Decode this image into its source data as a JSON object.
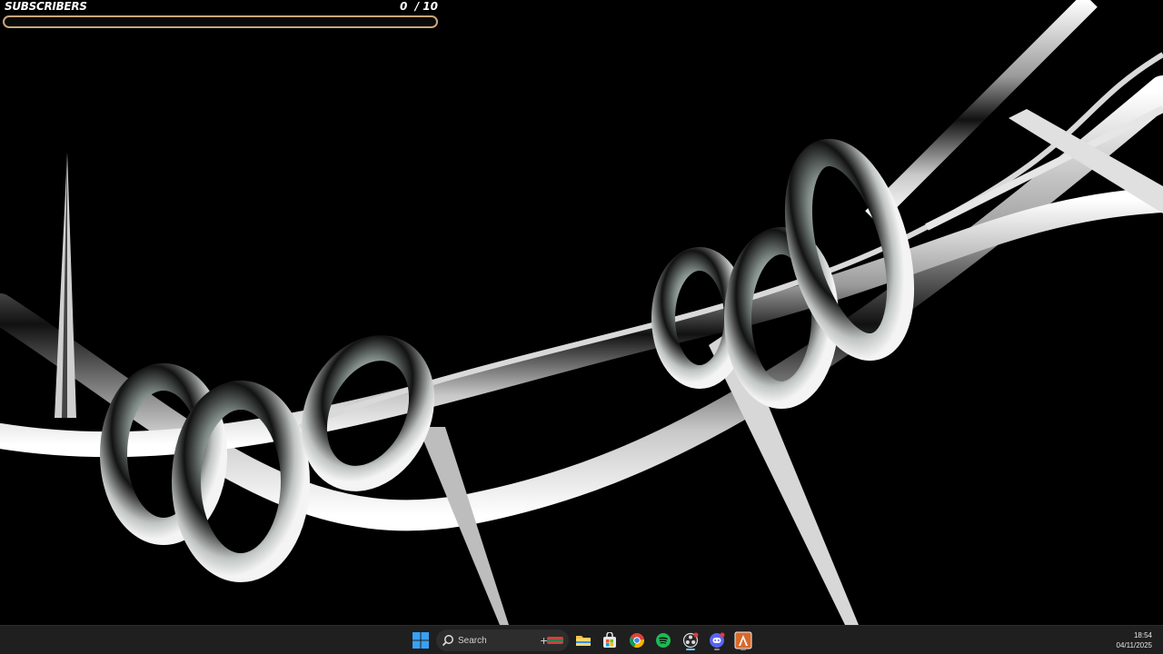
{
  "widget": {
    "label": "SUBSCRIBERS",
    "current": "0",
    "goal": "/ 10",
    "progress": 0,
    "accent": "#c9a77c"
  },
  "taskbar": {
    "search_placeholder": "Search",
    "apps": [
      {
        "name": "windows-start",
        "icon": "windows-logo-icon"
      },
      {
        "name": "file-explorer",
        "icon": "folder-icon"
      },
      {
        "name": "microsoft-store",
        "icon": "store-icon"
      },
      {
        "name": "google-chrome",
        "icon": "chrome-icon"
      },
      {
        "name": "spotify",
        "icon": "spotify-icon"
      },
      {
        "name": "obs-studio",
        "icon": "obs-icon"
      },
      {
        "name": "discord",
        "icon": "discord-icon"
      },
      {
        "name": "recording-app",
        "icon": "app-a-icon"
      }
    ],
    "clock": {
      "time": "18:54",
      "date": "04/11/2025"
    }
  },
  "colors": {
    "taskbar_bg": "#1f1f1f",
    "accent_blue": "#60cdff",
    "spotify_green": "#1db954",
    "discord_blurple": "#5865f2"
  }
}
